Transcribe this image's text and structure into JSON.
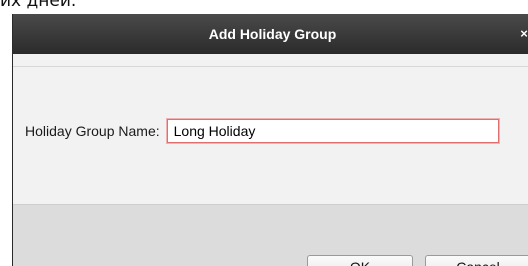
{
  "top_text": "их дней.",
  "dialog": {
    "title": "Add Holiday Group",
    "close_glyph": "×",
    "field_label": "Holiday Group Name:",
    "field_value": "Long Holiday",
    "ok_label": "OK",
    "cancel_label": "Cancel"
  },
  "colors": {
    "titlebar": "#2e2e2e",
    "input_focus_border": "#e07070",
    "footer": "#dcdcdc"
  }
}
